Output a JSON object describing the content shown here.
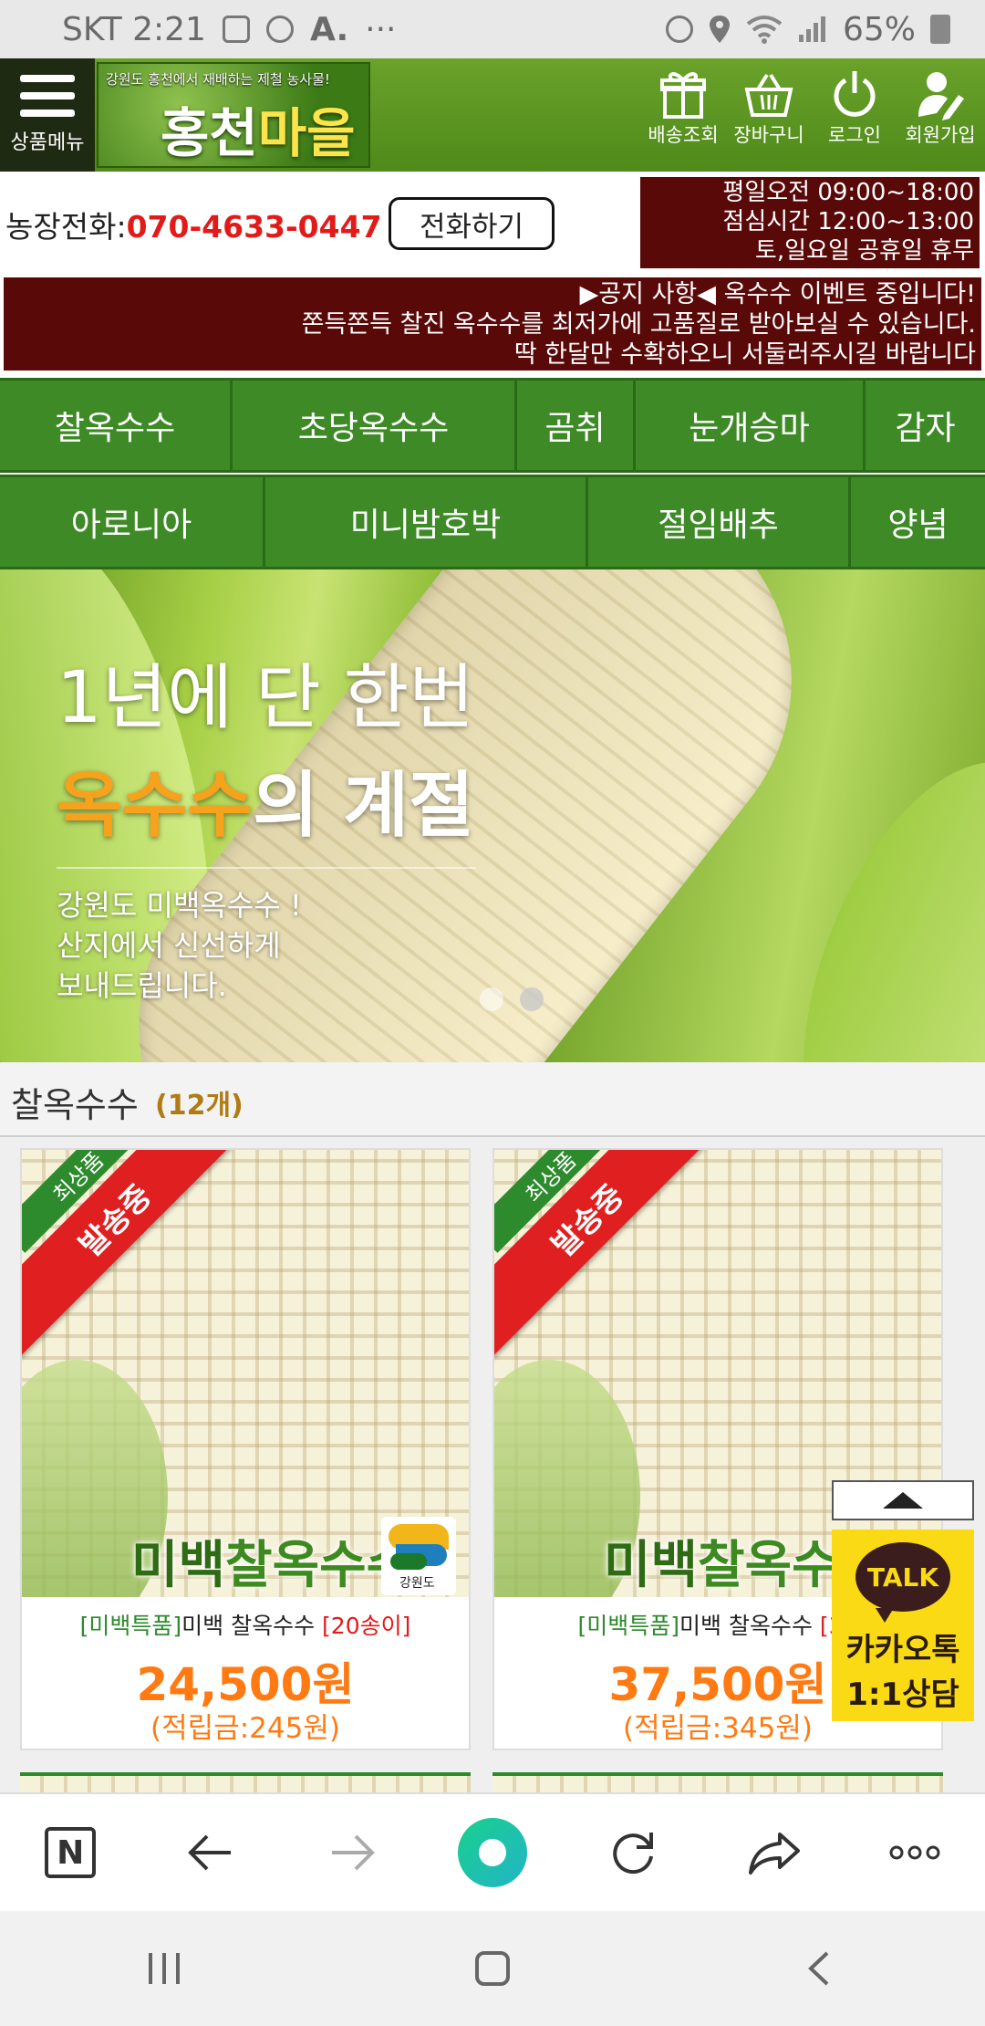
{
  "status_bar": {
    "carrier_time": "SKT 2:21",
    "notification_icons": [
      "image-icon",
      "compass-icon",
      "font-icon"
    ],
    "more": "···",
    "battery": "65%"
  },
  "header": {
    "menu_label": "상품메뉴",
    "logo_subtitle": "강원도 홍천에서 재배하는 제철 농사물!",
    "logo_name_a": "홍천",
    "logo_name_b": "마을",
    "nav": [
      {
        "label": "배송조회",
        "icon": "gift-icon"
      },
      {
        "label": "장바구니",
        "icon": "basket-icon"
      },
      {
        "label": "로그인",
        "icon": "power-icon"
      },
      {
        "label": "회원가입",
        "icon": "user-pen-icon"
      }
    ]
  },
  "contact": {
    "phone_label": "농장전화:",
    "phone_number": "070-4633-0447",
    "call_button": "전화하기",
    "hours": [
      "평일오전 09:00~18:00",
      "점심시간 12:00~13:00",
      "토,일요일 공휴일 휴무"
    ]
  },
  "notice": {
    "lines": [
      "▶공지 사항◀ 옥수수 이벤트 중입니다!",
      "쫀득쫀득 찰진 옥수수를 최저가에 고품질로 받아보실 수 있습니다.",
      "딱 한달만 수확하오니 서둘러주시길 바랍니다"
    ]
  },
  "categories": {
    "row1": [
      "찰옥수수",
      "초당옥수수",
      "곰취",
      "눈개승마",
      "감자"
    ],
    "row2": [
      "아로니아",
      "미니밤호박",
      "절임배추",
      "양념"
    ]
  },
  "banner": {
    "line1": "1년에 단 한번",
    "line2_highlight": "옥수수",
    "line2_rest": "의 계절",
    "sub": [
      "강원도 미백옥수수 !",
      "산지에서 신선하게",
      "보내드립니다."
    ],
    "slide_count": 2,
    "active_slide": 2
  },
  "section": {
    "title": "찰옥수수",
    "count": "(12개)"
  },
  "products": [
    {
      "ribbon_top": "최상품",
      "ribbon": "발송중",
      "image_title_a": "미백",
      "image_title_b": "찰옥수수",
      "seal_text": "강원도",
      "tag": "[미백특품]",
      "name": "미백 찰옥수수 ",
      "option": "[20송이]",
      "price": "24,500원",
      "points": "(적립금:245원)"
    },
    {
      "ribbon_top": "최상품",
      "ribbon": "발송중",
      "image_title_a": "미백",
      "image_title_b": "찰옥수수",
      "seal_text": "",
      "tag": "[미백특품]",
      "name": "미백 찰옥수수 ",
      "option": "[30",
      "price": "37,500원",
      "points": "(적립금:345원)"
    }
  ],
  "floating": {
    "kakao_bubble": "TALK",
    "kakao_line1": "카카오톡",
    "kakao_line2": "1:1상담"
  },
  "browser_bar": {
    "home_letter": "N",
    "buttons": [
      "naver-home-icon",
      "back-arrow-icon",
      "forward-arrow-icon",
      "green-dot-icon",
      "refresh-icon",
      "share-icon",
      "more-icon"
    ]
  },
  "colors": {
    "header_green": "#4f8a1a",
    "nav_green": "#3d8a26",
    "notice_maroon": "#5a0909",
    "price_orange": "#ff7a12",
    "phone_red": "#e21a1a",
    "kakao_yellow": "#fada14"
  }
}
